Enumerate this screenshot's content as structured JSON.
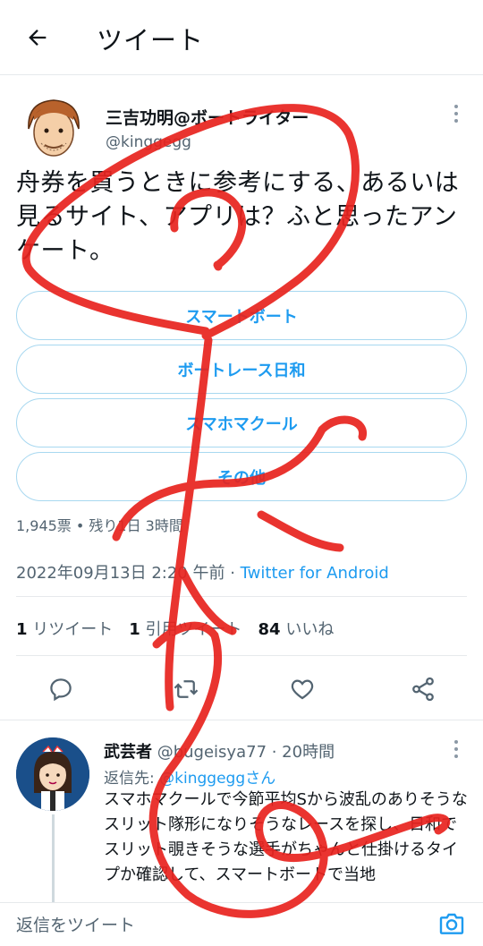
{
  "header": {
    "back_icon": "arrow-left-icon",
    "title": "ツイート"
  },
  "tweet": {
    "author_name": "三吉功明@ボートライター",
    "author_handle": "@kinggegg",
    "text": "舟券を買うときに参考にする、あるいは見るサイト、アプリは？ふと思ったアンケート。",
    "poll": {
      "options": [
        "スマートボート",
        "ボートレース日和",
        "スマホマクール",
        "その他"
      ],
      "meta": "1,945票 • 残り1日 3時間"
    },
    "timestamp": "2022年09月13日 2:20 午前 · ",
    "source": "Twitter for Android",
    "stats": {
      "retweets_count": "1",
      "retweets_label": "リツイート",
      "quotes_count": "1",
      "quotes_label": "引用ツイート",
      "likes_count": "84",
      "likes_label": "いいね"
    },
    "actions": [
      "reply-icon",
      "retweet-icon",
      "heart-icon",
      "share-icon"
    ]
  },
  "reply": {
    "author_name": "武芸者",
    "author_handle": " @bugeisya77 · 20時間",
    "reply_to_label": "返信先: ",
    "reply_to_mention": "@kinggeggさん",
    "text": "スマホマクールで今節平均Sから波乱のありそうなスリット隊形になりそうなレースを探し、日和でスリット覗きそうな選手がちゃんと仕掛けるタイプか確認して、スマートボートで当地"
  },
  "composer": {
    "placeholder": "返信をツイート",
    "camera_icon": "camera-icon"
  },
  "colors": {
    "accent": "#1d9bf0",
    "text": "#0f1419",
    "secondary": "#536471",
    "border": "#e6e9ec",
    "scribble": "#e8231e"
  }
}
